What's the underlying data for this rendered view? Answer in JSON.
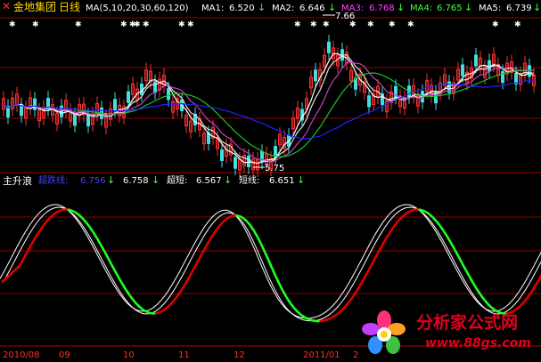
{
  "window": {
    "stock_name": "金地集团",
    "period": "日线"
  },
  "top_bar": {
    "ma_label": "MA(5,10,20,30,60,120)",
    "ma1": {
      "name": "MA1:",
      "value": "6.520",
      "arrow": "↓",
      "color": "#ffffff"
    },
    "ma2": {
      "name": "MA2:",
      "value": "6.646",
      "arrow": "↓",
      "color": "#ffffff"
    },
    "ma3": {
      "name": "MA3:",
      "value": "6.768",
      "arrow": "↓",
      "color": "#ff40ff"
    },
    "ma4": {
      "name": "MA4:",
      "value": "6.765",
      "arrow": "↓",
      "color": "#40ff40"
    },
    "ma5": {
      "name": "MA5:",
      "value": "6.739",
      "arrow": "↓",
      "color": "#ffffff"
    }
  },
  "price_panel": {
    "high_marker": "7.66",
    "low_marker": "5.75"
  },
  "indicator_bar": {
    "name": "主升浪",
    "line1": {
      "name": "超跌线:",
      "value": "6.756",
      "arrow": "↓",
      "color": "#4040ff"
    },
    "line2": {
      "name": "",
      "value": "6.758",
      "arrow": "↓",
      "color": "#ffffff"
    },
    "line3": {
      "name": "超短:",
      "value": "6.567",
      "arrow": "↓",
      "color": "#ffffff"
    },
    "line4": {
      "name": "短线:",
      "value": "6.651",
      "arrow": "↓",
      "color": "#ffffff"
    }
  },
  "time_axis": {
    "labels": [
      "2010/08",
      "09",
      "10",
      "11",
      "12",
      "2011/01",
      "2"
    ]
  },
  "watermark": {
    "title": "分析家公式网",
    "url": "www.88gs.com"
  },
  "colors": {
    "background": "#000000",
    "grid": "#8b0000",
    "up_candle": "#ff3030",
    "down_candle": "#40e0e0",
    "ma_blue": "#2020ff",
    "ma_green": "#20c020",
    "ma_magenta": "#c040c0",
    "ma_white": "#ffffff",
    "rise_wave": "#e00000",
    "fall_wave": "#20ff20",
    "label_gold": "#ffd700",
    "watermark_red": "#e00020"
  }
}
